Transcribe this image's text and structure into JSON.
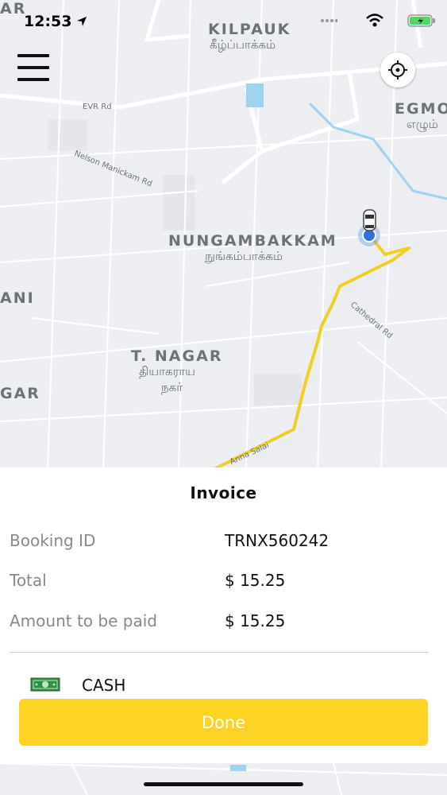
{
  "status_bar": {
    "time": "12:53"
  },
  "map": {
    "labels": {
      "kilpauk": "KILPAUK",
      "kilpauk_ta": "கீழ்ப்பாக்கம்",
      "egmore": "EGMO",
      "egmore_ta": "எழும்",
      "nungambakkam": "NUNGAMBAKKAM",
      "nungambakkam_ta": "நுங்கம்பாக்கம்",
      "ani": "ANI",
      "t_nagar": "T. NAGAR",
      "t_nagar_ta_1": "தியாகராய",
      "t_nagar_ta_2": "நகர்",
      "gar": "GAR",
      "ar": "AR"
    },
    "roads": {
      "evr": "EVR Rd",
      "nelson": "Nelson Manickam Rd",
      "cathedral": "Cathedral Rd",
      "anna": "Anna Salai"
    },
    "route_color": "#f2cf24"
  },
  "invoice": {
    "title": "Invoice",
    "rows": [
      {
        "label": "Booking ID",
        "value": "TRNX560242"
      },
      {
        "label": "Total",
        "value": "$ 15.25"
      },
      {
        "label": "Amount to be paid",
        "value": "$ 15.25"
      }
    ],
    "payment_method": "CASH",
    "done_label": "Done",
    "accent": "#fdd224"
  }
}
